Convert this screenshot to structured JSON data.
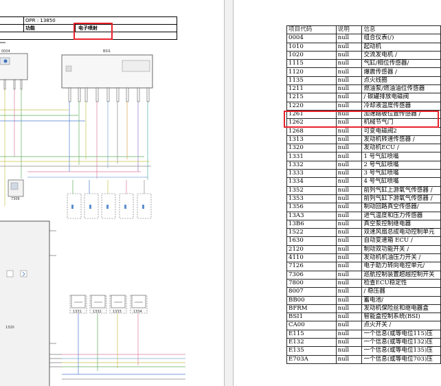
{
  "left_page": {
    "header": {
      "opr": "OPR : 13850",
      "function_label": "功能",
      "function_value": "电子喷射"
    },
    "labels": {
      "c0004": "0004",
      "bsi1": "BSI1",
      "c7306": "7306",
      "c1331": "1331",
      "c1332": "1332",
      "c1333": "1333",
      "c1334": "1334",
      "c1320": "1320"
    }
  },
  "right_page": {
    "columns": [
      "项目代码",
      "说明",
      "信息"
    ],
    "rows": [
      [
        "0004",
        "null",
        "组合仪表(/)"
      ],
      [
        "1010",
        "null",
        "起动机"
      ],
      [
        "1020",
        "null",
        "交流发电机 /"
      ],
      [
        "1115",
        "null",
        "气缸/相位传感器/"
      ],
      [
        "1120",
        "null",
        "爆震传感器 /"
      ],
      [
        "1135",
        "null",
        "点火线圈"
      ],
      [
        "1211",
        "null",
        "燃油泵/燃油油位传感器"
      ],
      [
        "1215",
        "null",
        "/ 碳罐排放电磁阀"
      ],
      [
        "1220",
        "null",
        "冷却液温度传感器"
      ],
      [
        "1261",
        "null",
        "加速踏板位置传感器 /"
      ],
      [
        "1262",
        "null",
        "机械节气门"
      ],
      [
        "1268",
        "null",
        "可变电磁阀2"
      ],
      [
        "1313",
        "null",
        "发动机转速传感器 /"
      ],
      [
        "1320",
        "null",
        "发动机ECU /"
      ],
      [
        "1331",
        "null",
        "1 号气缸喷嘴"
      ],
      [
        "1332",
        "null",
        "2 号气缸喷嘴"
      ],
      [
        "1333",
        "null",
        "3 号气缸喷嘴"
      ],
      [
        "1334",
        "null",
        "4 号气缸喷嘴"
      ],
      [
        "1352",
        "null",
        "前列气缸上游氧气传感器 /"
      ],
      [
        "1353",
        "null",
        "前列气缸下游氧气传感器 /"
      ],
      [
        "1356",
        "null",
        "制动回路真空传感器/"
      ],
      [
        "13A3",
        "null",
        "进气温度和压力传感器"
      ],
      [
        "13B6",
        "null",
        "真空泵控制继电器"
      ],
      [
        "1522",
        "null",
        "双速风扇总成电动控制单元"
      ],
      [
        "1630",
        "null",
        "自动变速箱 ECU /"
      ],
      [
        "2120",
        "null",
        "制动双功能开关 /"
      ],
      [
        "4110",
        "null",
        "发动机机油压力开关 /"
      ],
      [
        "7126",
        "null",
        "电子助力转向电控单元/"
      ],
      [
        "7306",
        "null",
        "巡航控制装置超越控制开关"
      ],
      [
        "7800",
        "null",
        "检查ECU稳定性"
      ],
      [
        "8007",
        "null",
        "/ 稳压器"
      ],
      [
        "BB00",
        "null",
        "蓄电池/"
      ],
      [
        "BFRM",
        "null",
        "发动机保险丝和继电器盒"
      ],
      [
        "BSI1",
        "null",
        "智能盒控制系统(BSI)"
      ],
      [
        "CA00",
        "null",
        "点火开关 /"
      ],
      [
        "E115",
        "null",
        "一个信息(或等电位115)压"
      ],
      [
        "E132",
        "null",
        "一个信息(或等电位132)压"
      ],
      [
        "E135",
        "null",
        "一个信息(或等电位135)压"
      ],
      [
        "E703A",
        "null",
        "一个信息(或等电位703)压"
      ]
    ]
  },
  "colors": {
    "highlight": "#e8222a",
    "divider": "#bdbdbd"
  }
}
